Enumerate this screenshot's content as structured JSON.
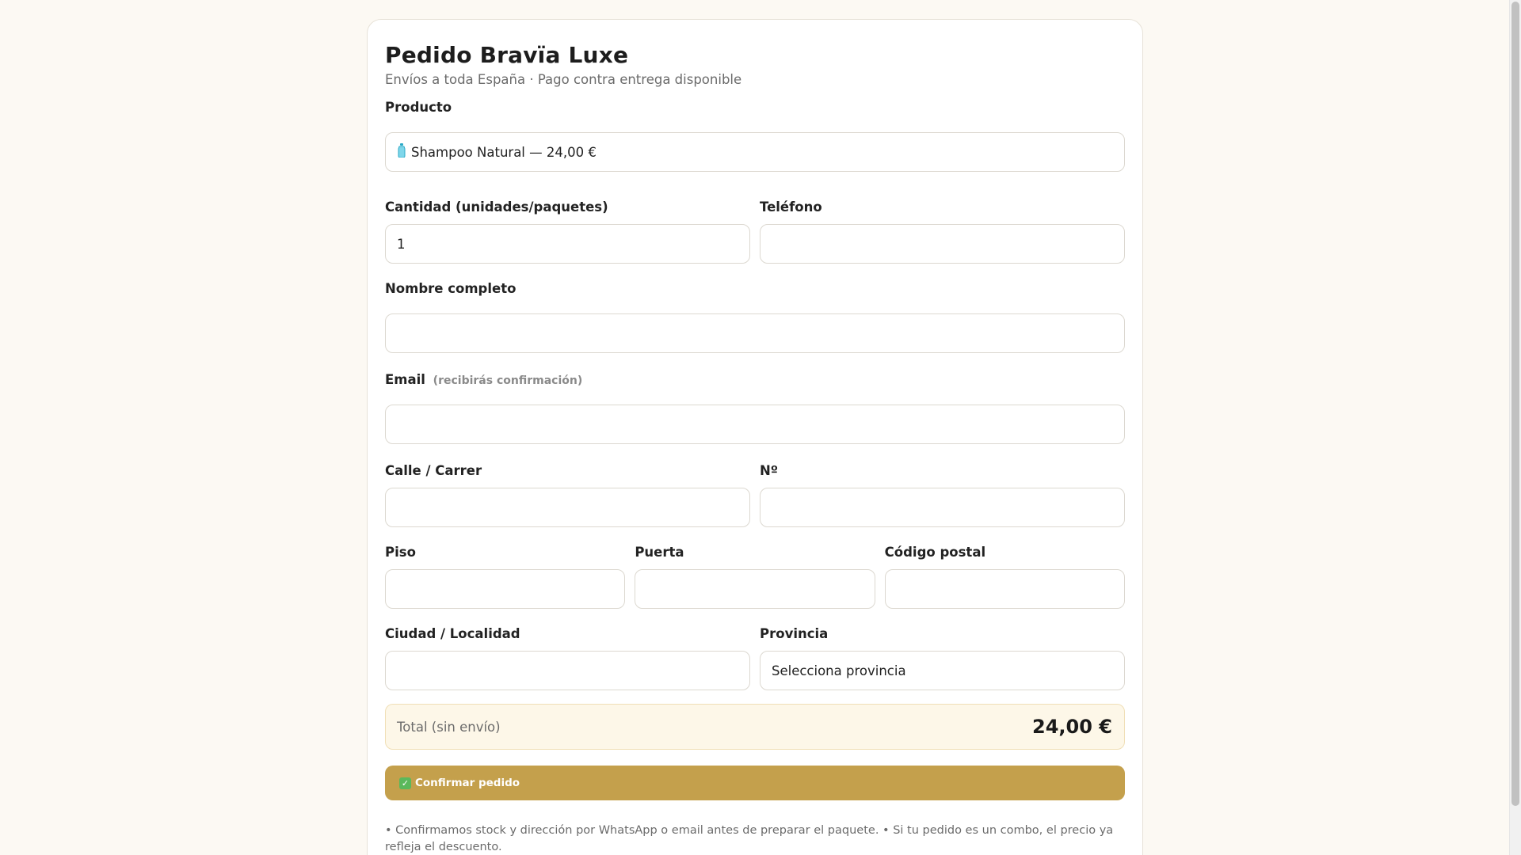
{
  "header": {
    "title": "Pedido Bravïa Luxe",
    "subtitle": "Envíos a toda España · Pago contra entrega disponible"
  },
  "form": {
    "product": {
      "label": "Producto",
      "icon": "bottle-icon",
      "value": "Shampoo Natural — 24,00 €"
    },
    "quantity": {
      "label": "Cantidad (unidades/paquetes)",
      "value": "1"
    },
    "phone": {
      "label": "Teléfono",
      "value": ""
    },
    "name": {
      "label": "Nombre completo",
      "value": ""
    },
    "email": {
      "label": "Email",
      "hint": "(recibirás confirmación)",
      "value": ""
    },
    "street": {
      "label": "Calle / Carrer",
      "value": ""
    },
    "number": {
      "label": "Nº",
      "value": ""
    },
    "floor": {
      "label": "Piso",
      "value": ""
    },
    "door": {
      "label": "Puerta",
      "value": ""
    },
    "postal_code": {
      "label": "Código postal",
      "value": ""
    },
    "city": {
      "label": "Ciudad / Localidad",
      "value": ""
    },
    "province": {
      "label": "Provincia",
      "value": "Selecciona provincia"
    }
  },
  "total": {
    "label": "Total (sin envío)",
    "value": "24,00 €"
  },
  "confirm": {
    "icon": "check-icon",
    "label": "Confirmar pedido"
  },
  "footnote": "• Confirmamos stock y dirección por WhatsApp o email antes de preparar el paquete. • Si tu pedido es un combo, el precio ya refleja el descuento.",
  "colors": {
    "accent": "#c4a04c",
    "total_bg": "#fdf7e8",
    "page_bg": "#fcf9f3"
  }
}
